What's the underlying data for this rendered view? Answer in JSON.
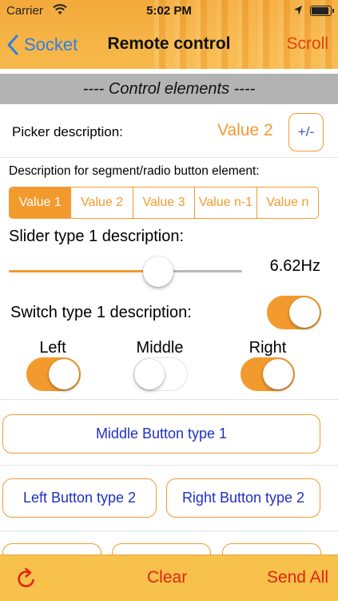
{
  "status": {
    "carrier": "Carrier",
    "time": "5:02 PM",
    "battery_level": 0.85
  },
  "nav": {
    "back_label": "Socket",
    "title": "Remote control",
    "right_label": "Scroll"
  },
  "section": {
    "title": "---- Control elements ----"
  },
  "picker": {
    "label": "Picker description:",
    "value": "Value 2",
    "button_label": "+/-"
  },
  "segment": {
    "description": "Description for segment/radio button element:",
    "options": [
      "Value 1",
      "Value 2",
      "Value 3",
      "Value n-1",
      "Value n"
    ],
    "selected_index": 0
  },
  "slider": {
    "label": "Slider type 1 description:",
    "value_text": "6.62Hz",
    "fraction": 0.64
  },
  "switch1": {
    "label": "Switch type 1 description:",
    "on": true
  },
  "switches": [
    {
      "caption": "Left",
      "on": true
    },
    {
      "caption": "Middle",
      "on": false
    },
    {
      "caption": "Right",
      "on": true
    }
  ],
  "buttons": {
    "middle": "Middle Button type 1",
    "left": "Left Button type 2",
    "right": "Right Button type 2"
  },
  "toolbar": {
    "clear_label": "Clear",
    "send_label": "Send All"
  },
  "colors": {
    "accent": "#f39a2e",
    "nav_bg": "#f6b447",
    "toolbar_bg": "#f7c14b",
    "action_red": "#e0250f",
    "link_blue": "#2f7fe6"
  },
  "icons": [
    "wifi-icon",
    "location-arrow-icon",
    "battery-icon",
    "chevron-left-icon",
    "refresh-icon"
  ]
}
